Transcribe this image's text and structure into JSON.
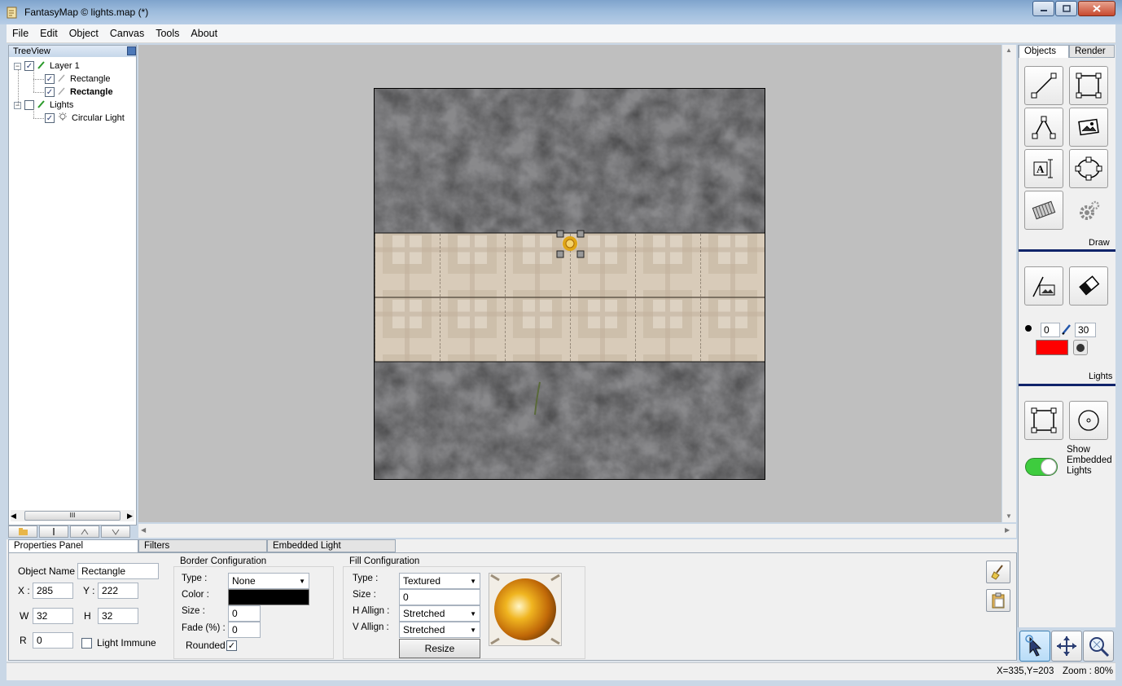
{
  "window": {
    "title": "FantasyMap © lights.map (*)"
  },
  "menu": [
    "File",
    "Edit",
    "Object",
    "Canvas",
    "Tools",
    "About"
  ],
  "treeview": {
    "title": "TreeView",
    "items": [
      {
        "label": "Layer 1",
        "checked": true
      },
      {
        "label": "Rectangle",
        "checked": true
      },
      {
        "label": "Rectangle",
        "checked": true
      },
      {
        "label": "Lights",
        "checked": false
      },
      {
        "label": "Circular Light",
        "checked": true
      }
    ],
    "scroll_grip": "III"
  },
  "right_tabs": [
    "Objects",
    "Render"
  ],
  "draw_label": "Draw",
  "lights_label": "Lights",
  "brush": {
    "size": "0",
    "opacity": "30",
    "color": "#ff0000"
  },
  "show_embedded_lights": "Show Embedded Lights",
  "bottom_tabs": [
    "Properties Panel",
    "Filters",
    "Embedded Light"
  ],
  "properties": {
    "object_name_label": "Object Name",
    "object_name": "Rectangle",
    "x_label": "X :",
    "x": "285",
    "y_label": "Y :",
    "y": "222",
    "w_label": "W",
    "w": "32",
    "h_label": "H",
    "h": "32",
    "r_label": "R",
    "r": "0",
    "light_immune": "Light Immune"
  },
  "border": {
    "title": "Border Configuration",
    "type_label": "Type :",
    "type": "None",
    "color_label": "Color :",
    "color": "#000000",
    "size_label": "Size :",
    "size": "0",
    "fade_label": "Fade (%) :",
    "fade": "0",
    "rounded": "Rounded"
  },
  "fill": {
    "title": "Fill Configuration",
    "type_label": "Type :",
    "type": "Textured",
    "size_label": "Size :",
    "size": "0",
    "halign_label": "H Allign :",
    "halign": "Stretched",
    "valign_label": "V Allign :",
    "valign": "Stretched",
    "resize": "Resize"
  },
  "status": {
    "coords": "X=335,Y=203",
    "zoom": "Zoom : 80%"
  }
}
